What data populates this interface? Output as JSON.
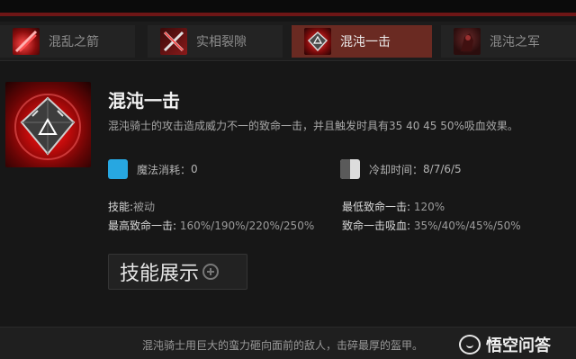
{
  "tabs": [
    {
      "label": "混乱之箭",
      "icon": "chaos-bolt-icon",
      "active": false
    },
    {
      "label": "实相裂隙",
      "icon": "reality-rift-icon",
      "active": false
    },
    {
      "label": "混沌一击",
      "icon": "chaos-strike-icon",
      "active": true
    },
    {
      "label": "混沌之军",
      "icon": "phantasm-icon",
      "active": false
    }
  ],
  "skill": {
    "title": "混沌一击",
    "description": "混沌骑士的攻击造成威力不一的致命一击，并且触发时具有35 40 45 50%吸血效果。",
    "mana_label": "魔法消耗：",
    "mana_value": "0",
    "cooldown_label": "冷却时间：",
    "cooldown_value": "8/7/6/5",
    "ability_label": "技能:",
    "ability_value": "被动",
    "min_crit_label": "最低致命一击:",
    "min_crit_value": "120%",
    "max_crit_label": "最高致命一击:",
    "max_crit_value": "160%/190%/220%/250%",
    "lifesteal_label": "致命一击吸血:",
    "lifesteal_value": "35%/40%/45%/50%"
  },
  "show_button": {
    "label": "技能展示"
  },
  "footer": {
    "lore": "混沌骑士用巨大的蛮力砸向面前的敌人，击碎最厚的盔甲。",
    "watermark": "悟空问答"
  },
  "colors": {
    "active_tab": "#6a2a22",
    "mana": "#27a7e1",
    "accent_red": "#6e1616"
  }
}
